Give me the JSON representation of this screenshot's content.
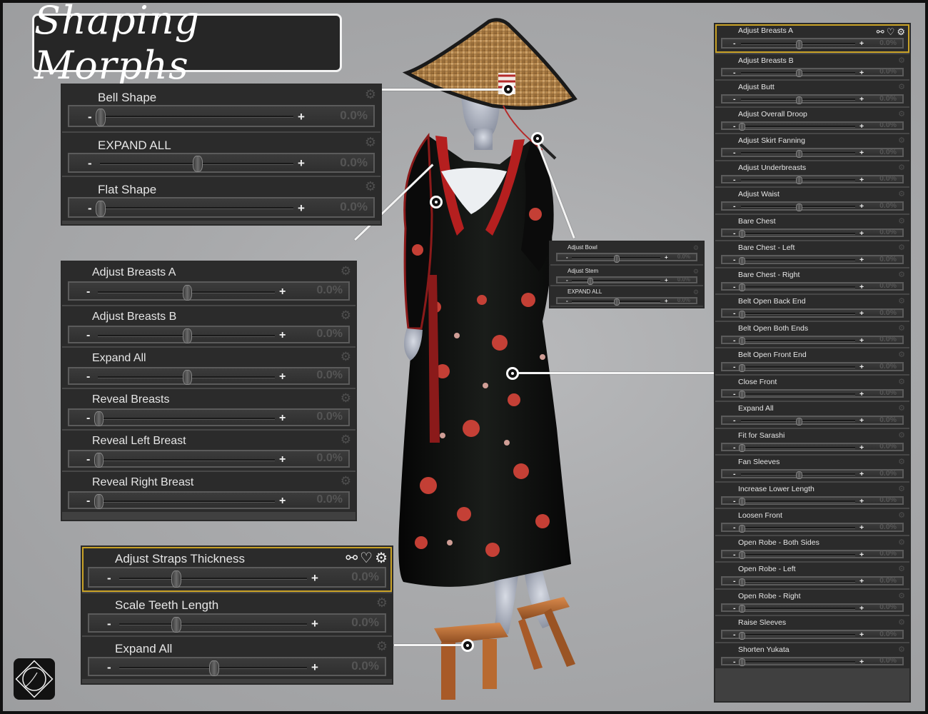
{
  "title": "Shaping Morphs",
  "colors": {
    "panel_bg": "#2b2b2b",
    "selected_outline": "#c9a227",
    "background": "#a9aaac"
  },
  "icons": {
    "gear": "gear-icon",
    "link": "link-icon",
    "heart": "heart-icon",
    "logo": "logo-icon"
  },
  "hat_panel": {
    "morphs": [
      {
        "label": "Bell Shape",
        "value": "0.0%",
        "position": 0
      },
      {
        "label": "EXPAND ALL",
        "value": "0.0%",
        "position": 0.5
      },
      {
        "label": "Flat Shape",
        "value": "0.0%",
        "position": 0
      }
    ]
  },
  "top_panel": {
    "morphs": [
      {
        "label": "Adjust Breasts A",
        "value": "0.0%",
        "position": 0.5
      },
      {
        "label": "Adjust Breasts B",
        "value": "0.0%",
        "position": 0.5
      },
      {
        "label": "Expand All",
        "value": "0.0%",
        "position": 0.5
      },
      {
        "label": "Reveal Breasts",
        "value": "0.0%",
        "position": 0
      },
      {
        "label": "Reveal Left Breast",
        "value": "0.0%",
        "position": 0
      },
      {
        "label": "Reveal Right Breast",
        "value": "0.0%",
        "position": 0
      }
    ]
  },
  "sandal_panel": {
    "morphs": [
      {
        "label": "Adjust Straps Thickness",
        "value": "0.0%",
        "position": 0.3
      },
      {
        "label": "Scale Teeth Length",
        "value": "0.0%",
        "position": 0.3
      },
      {
        "label": "Expand All",
        "value": "0.0%",
        "position": 0.5
      }
    ]
  },
  "pipe_panel": {
    "morphs": [
      {
        "label": "Adjust Bowl",
        "value": "0.0%",
        "position": 0.5
      },
      {
        "label": "Adjust Stem",
        "value": "0.0%",
        "position": 0.2
      },
      {
        "label": "EXPAND ALL",
        "value": "0.0%",
        "position": 0.5
      }
    ]
  },
  "robe_panel": {
    "morphs": [
      {
        "label": "Adjust Breasts A",
        "value": "0.0%",
        "position": 0.5
      },
      {
        "label": "Adjust Breasts B",
        "value": "0.0%",
        "position": 0.5
      },
      {
        "label": "Adjust Butt",
        "value": "0.0%",
        "position": 0.5
      },
      {
        "label": "Adjust Overall Droop",
        "value": "0.0%",
        "position": 0
      },
      {
        "label": "Adjust Skirt Fanning",
        "value": "0.0%",
        "position": 0.5
      },
      {
        "label": "Adjust Underbreasts",
        "value": "0.0%",
        "position": 0.5
      },
      {
        "label": "Adjust Waist",
        "value": "0.0%",
        "position": 0.5
      },
      {
        "label": "Bare Chest",
        "value": "0.0%",
        "position": 0
      },
      {
        "label": "Bare Chest - Left",
        "value": "0.0%",
        "position": 0
      },
      {
        "label": "Bare Chest - Right",
        "value": "0.0%",
        "position": 0
      },
      {
        "label": "Belt Open Back End",
        "value": "0.0%",
        "position": 0
      },
      {
        "label": "Belt Open Both Ends",
        "value": "0.0%",
        "position": 0
      },
      {
        "label": "Belt Open Front End",
        "value": "0.0%",
        "position": 0
      },
      {
        "label": "Close Front",
        "value": "0.0%",
        "position": 0
      },
      {
        "label": "Expand All",
        "value": "0.0%",
        "position": 0.5
      },
      {
        "label": "Fit for Sarashi",
        "value": "0.0%",
        "position": 0
      },
      {
        "label": "Fan Sleeves",
        "value": "0.0%",
        "position": 0.5
      },
      {
        "label": "Increase Lower Length",
        "value": "0.0%",
        "position": 0
      },
      {
        "label": "Loosen Front",
        "value": "0.0%",
        "position": 0
      },
      {
        "label": "Open Robe - Both Sides",
        "value": "0.0%",
        "position": 0
      },
      {
        "label": "Open Robe - Left",
        "value": "0.0%",
        "position": 0
      },
      {
        "label": "Open Robe - Right",
        "value": "0.0%",
        "position": 0
      },
      {
        "label": "Raise Sleeves",
        "value": "0.0%",
        "position": 0
      },
      {
        "label": "Shorten Yukata",
        "value": "0.0%",
        "position": 0
      }
    ]
  }
}
